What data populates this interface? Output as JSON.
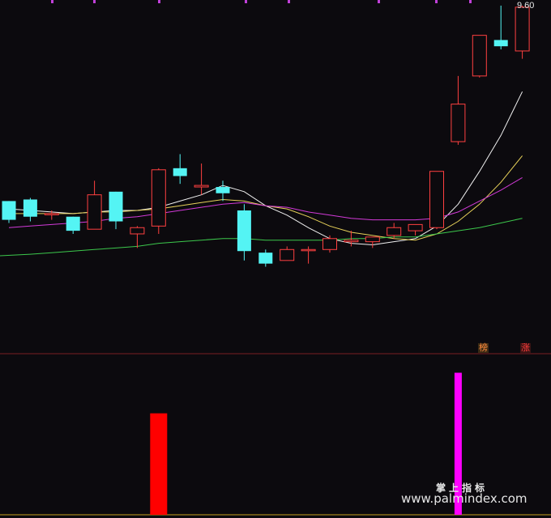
{
  "chart_data": {
    "type": "candlestick",
    "price_ylim": [
      11.0,
      33.0
    ],
    "max_label": "9.60",
    "candles": [
      {
        "o": 20.4,
        "h": 20.4,
        "l": 19.0,
        "c": 19.2
      },
      {
        "o": 20.5,
        "h": 20.6,
        "l": 19.1,
        "c": 19.4
      },
      {
        "o": 19.6,
        "h": 19.8,
        "l": 19.2,
        "c": 19.6
      },
      {
        "o": 19.4,
        "h": 19.4,
        "l": 18.3,
        "c": 18.5
      },
      {
        "o": 18.6,
        "h": 21.7,
        "l": 18.6,
        "c": 20.8
      },
      {
        "o": 21.0,
        "h": 21.0,
        "l": 18.6,
        "c": 19.1
      },
      {
        "o": 18.3,
        "h": 18.8,
        "l": 17.4,
        "c": 18.7
      },
      {
        "o": 18.8,
        "h": 22.5,
        "l": 18.3,
        "c": 22.4
      },
      {
        "o": 22.5,
        "h": 23.4,
        "l": 21.5,
        "c": 22.0
      },
      {
        "o": 21.3,
        "h": 22.8,
        "l": 20.8,
        "c": 21.4
      },
      {
        "o": 21.3,
        "h": 21.7,
        "l": 20.4,
        "c": 20.9
      },
      {
        "o": 19.8,
        "h": 20.2,
        "l": 16.6,
        "c": 17.2
      },
      {
        "o": 17.1,
        "h": 17.3,
        "l": 16.2,
        "c": 16.4
      },
      {
        "o": 16.6,
        "h": 17.5,
        "l": 16.6,
        "c": 17.3
      },
      {
        "o": 17.3,
        "h": 17.5,
        "l": 16.4,
        "c": 17.3
      },
      {
        "o": 17.3,
        "h": 18.2,
        "l": 17.1,
        "c": 18.0
      },
      {
        "o": 17.8,
        "h": 18.5,
        "l": 17.5,
        "c": 17.9
      },
      {
        "o": 17.8,
        "h": 18.1,
        "l": 17.4,
        "c": 18.1
      },
      {
        "o": 18.2,
        "h": 19.0,
        "l": 18.0,
        "c": 18.7
      },
      {
        "o": 18.5,
        "h": 18.9,
        "l": 18.2,
        "c": 18.9
      },
      {
        "o": 18.7,
        "h": 22.3,
        "l": 18.6,
        "c": 22.3
      },
      {
        "o": 24.2,
        "h": 28.4,
        "l": 24.0,
        "c": 26.6
      },
      {
        "o": 28.4,
        "h": 29.1,
        "l": 28.3,
        "c": 31.0
      },
      {
        "o": 30.7,
        "h": 32.9,
        "l": 30.1,
        "c": 30.3
      },
      {
        "o": 30.0,
        "h": 32.9,
        "l": 29.5,
        "c": 32.8
      }
    ],
    "ma_lines": [
      {
        "color": "#f0f0f0",
        "values": [
          19.9,
          19.8,
          19.7,
          19.6,
          19.7,
          19.8,
          19.8,
          20.0,
          20.4,
          20.8,
          21.4,
          21.0,
          20.1,
          19.5,
          18.7,
          18.0,
          17.7,
          17.6,
          17.8,
          18.0,
          18.8,
          20.2,
          22.3,
          24.6,
          27.4
        ]
      },
      {
        "color": "#e8d25a",
        "values": [
          19.6,
          19.6,
          19.6,
          19.6,
          19.7,
          19.7,
          19.8,
          19.9,
          20.1,
          20.3,
          20.5,
          20.4,
          20.1,
          19.9,
          19.4,
          18.8,
          18.4,
          18.2,
          18.0,
          17.9,
          18.3,
          19.1,
          20.2,
          21.6,
          23.3
        ]
      },
      {
        "color": "#d23ad8",
        "values": [
          18.7,
          18.8,
          18.9,
          19.0,
          19.1,
          19.3,
          19.4,
          19.6,
          19.8,
          20.0,
          20.2,
          20.3,
          20.1,
          20.0,
          19.7,
          19.5,
          19.3,
          19.2,
          19.2,
          19.2,
          19.3,
          19.7,
          20.4,
          21.1,
          21.9
        ]
      },
      {
        "color": "#3cc84c",
        "values": [
          16.9,
          17.0,
          17.1,
          17.2,
          17.3,
          17.4,
          17.5,
          17.7,
          17.8,
          17.9,
          18.0,
          18.0,
          17.9,
          17.9,
          17.9,
          17.9,
          18.0,
          18.0,
          18.1,
          18.1,
          18.3,
          18.5,
          18.7,
          19.0,
          19.3
        ]
      }
    ],
    "indicator_bars": [
      {
        "index": 7,
        "value": 1.0,
        "color": "#ff0000"
      },
      {
        "index": 21,
        "value": 1.4,
        "color": "#ff00ff"
      }
    ],
    "indicator_ylim": [
      0,
      1.5
    ],
    "tags": [
      {
        "name": "tag-bang",
        "text": "榜"
      },
      {
        "name": "tag-zhang",
        "text": "涨"
      }
    ]
  },
  "watermark": {
    "line1": "掌上指标",
    "line2": "www.palmindex.com"
  }
}
